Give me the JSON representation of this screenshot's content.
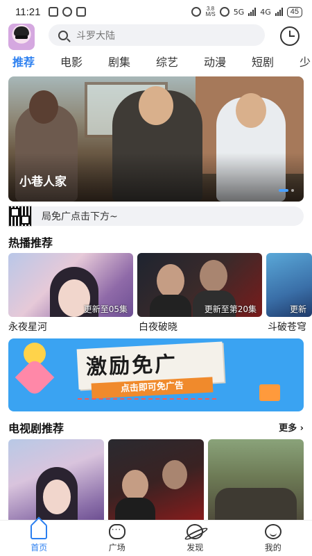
{
  "status_bar": {
    "time": "11:21",
    "net_speed_top": "3.8",
    "net_speed_bottom": "M/S",
    "signal_1": "5G",
    "signal_2": "4G",
    "battery": "45"
  },
  "search": {
    "placeholder": "斗罗大陆"
  },
  "tabs": [
    "推荐",
    "电影",
    "剧集",
    "综艺",
    "动漫",
    "短剧",
    "少"
  ],
  "active_tab": 0,
  "banner": {
    "title": "小巷人家",
    "slides": 2,
    "current_slide": 0
  },
  "notice": {
    "text": "局免广点击下方~"
  },
  "hot": {
    "title": "热播推荐",
    "items": [
      {
        "name": "永夜星河",
        "badge": "更新至05集"
      },
      {
        "name": "白夜破晓",
        "badge": "更新至第20集"
      },
      {
        "name": "斗破苍穹",
        "badge": "更新"
      }
    ]
  },
  "ad": {
    "headline": "激励免广",
    "cta": "点击即可免广告"
  },
  "tv": {
    "title": "电视剧推荐",
    "more": "更多 ›"
  },
  "colors": {
    "accent": "#2b7ff0"
  },
  "bottom_nav": [
    {
      "label": "首页",
      "icon": "home-icon"
    },
    {
      "label": "广场",
      "icon": "chat-icon"
    },
    {
      "label": "发现",
      "icon": "planet-icon"
    },
    {
      "label": "我的",
      "icon": "smile-icon"
    }
  ],
  "active_nav": 0
}
